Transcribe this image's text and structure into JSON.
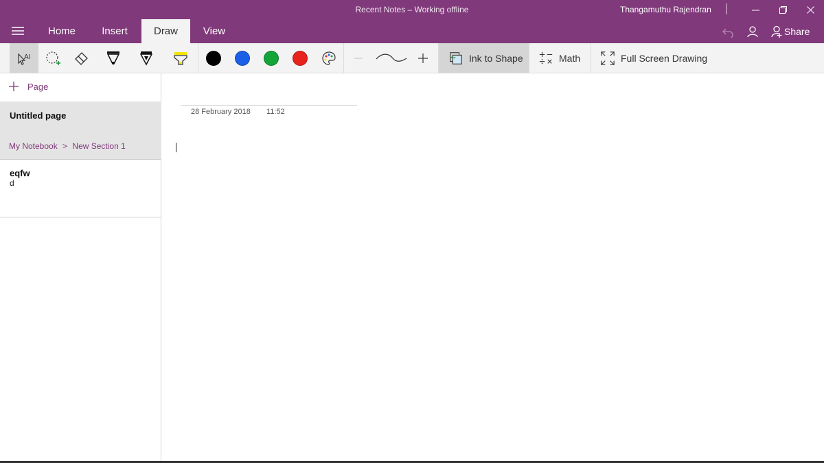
{
  "window": {
    "title": "Recent Notes – Working offline",
    "user": "Thangamuthu Rajendran"
  },
  "tabs": [
    {
      "label": "Home"
    },
    {
      "label": "Insert"
    },
    {
      "label": "Draw",
      "active": true
    },
    {
      "label": "View"
    }
  ],
  "top_actions": {
    "share_label": "Share"
  },
  "ribbon": {
    "tools": [
      "type-select-icon",
      "lasso-select-icon",
      "eraser-icon",
      "pen-black-icon",
      "pen-black-2-icon",
      "highlighter-yellow-icon"
    ],
    "colors": [
      "#000000",
      "#1a5fe6",
      "#13a538",
      "#e6231c"
    ],
    "ink_to_shape_label": "Ink to Shape",
    "ink_to_shape_selected": true,
    "math_label": "Math",
    "full_screen_label": "Full Screen Drawing"
  },
  "sidebar": {
    "add_page_label": "Page",
    "pages": [
      {
        "title": "Untitled page",
        "notebook": "My Notebook",
        "separator": ">",
        "section": "New Section 1"
      },
      {
        "title": "eqfw",
        "preview": "d"
      }
    ]
  },
  "note": {
    "date": "28 February 2018",
    "time": "11:52"
  },
  "colors": {
    "brand": "#80397b",
    "ribbon_bg": "#f3f3f3"
  }
}
